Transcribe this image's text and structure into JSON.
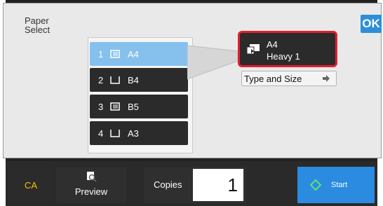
{
  "title": "Paper\nSelect",
  "ok_label": "OK",
  "trays": [
    {
      "number": "1",
      "size": "A4",
      "selected": true
    },
    {
      "number": "2",
      "size": "B4",
      "selected": false
    },
    {
      "number": "3",
      "size": "B5",
      "selected": false
    },
    {
      "number": "4",
      "size": "A3",
      "selected": false
    }
  ],
  "info": {
    "size": "A4",
    "type": "Heavy 1"
  },
  "type_size_label": "Type and Size",
  "bottom": {
    "ca_label": "CA",
    "preview_label": "Preview",
    "copies_label": "Copies",
    "copies_value": "1",
    "start_label": "Start"
  },
  "colors": {
    "accent": "#2e8fd8",
    "selected_tray": "#86c1ee",
    "highlight": "#e0202e",
    "ca_text": "#f2c400"
  }
}
